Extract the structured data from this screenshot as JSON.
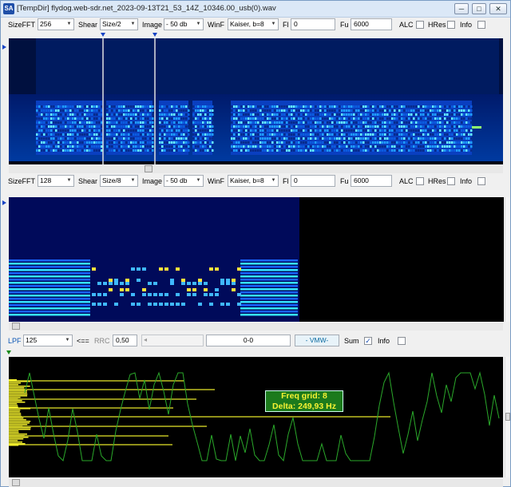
{
  "window": {
    "icon_text": "SA",
    "title": "[TempDir] flydog.web-sdr.net_2023-09-13T21_53_14Z_10346.00_usb(0).wav",
    "min_glyph": "─",
    "max_glyph": "□",
    "close_glyph": "✕"
  },
  "toolbar1": {
    "sizefft_label": "SizeFFT",
    "sizefft_value": "256",
    "shear_label": "Shear",
    "shear_value": "Size/2",
    "image_label": "Image",
    "image_value": "- 50 db",
    "winf_label": "WinF",
    "winf_value": "Kaiser, b=8",
    "fl_label": "Fl",
    "fl_value": "0",
    "fu_label": "Fu",
    "fu_value": "6000",
    "alc_label": "ALC",
    "alc_checked": false,
    "hres_label": "HRes",
    "hres_checked": false,
    "info_label": "Info",
    "info_checked": false
  },
  "toolbar2": {
    "sizefft_label": "SizeFFT",
    "sizefft_value": "128",
    "shear_label": "Shear",
    "shear_value": "Size/8",
    "image_label": "Image",
    "image_value": "- 50 db",
    "winf_label": "WinF",
    "winf_value": "Kaiser, b=8",
    "fl_label": "Fl",
    "fl_value": "0",
    "fu_label": "Fu",
    "fu_value": "6000",
    "alc_label": "ALC",
    "alc_checked": false,
    "hres_label": "HRes",
    "hres_checked": false,
    "info_label": "Info",
    "info_checked": false
  },
  "toolbar3": {
    "lpf_label": "LPF",
    "lpf_value": "125",
    "arrow_text": "<==",
    "rrc_label": "RRC",
    "rrc_value": "0,50",
    "range_value": "0-0",
    "vmw_label": "- VMW-",
    "sum_label": "Sum",
    "sum_checked": true,
    "info_label": "Info",
    "info_checked": false
  },
  "overlay": {
    "freq_grid": "Freq grid: 8",
    "delta": "Delta: 249,93 Hz"
  },
  "colors": {
    "spectrum_low": "#000a3c",
    "spectrum_mid": "#1a74ff",
    "spectrum_high": "#ffe23a",
    "waveform": "#2aa82a",
    "grid_lines": "#e5e52b",
    "marker": "#1843c4"
  }
}
